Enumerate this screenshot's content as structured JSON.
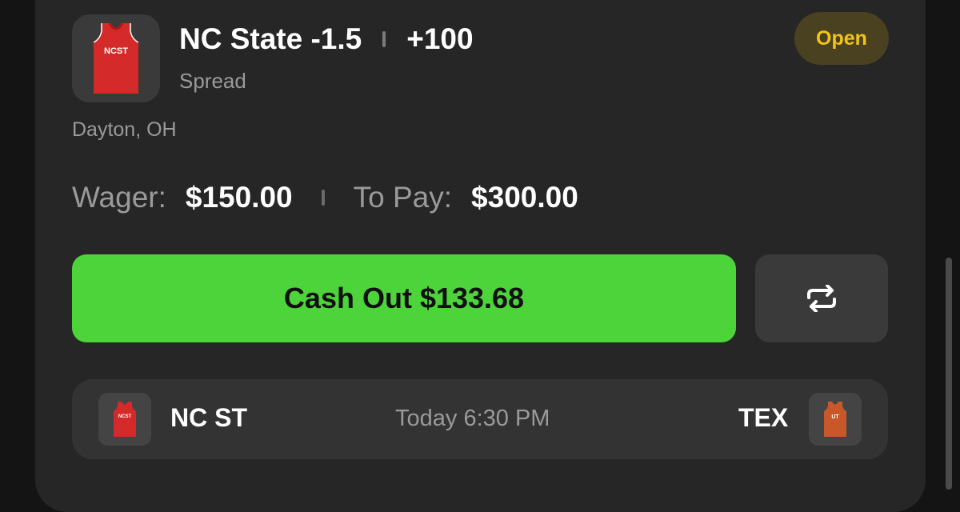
{
  "bet": {
    "selection": "NC State -1.5",
    "odds": "+100",
    "type": "Spread",
    "status": "Open",
    "location": "Dayton, OH"
  },
  "amounts": {
    "wager_label": "Wager:",
    "wager_value": "$150.00",
    "topay_label": "To Pay:",
    "topay_value": "$300.00"
  },
  "actions": {
    "cashout_label": "Cash Out $133.68",
    "repeat_icon": "repeat-icon"
  },
  "matchup": {
    "home_team": "NC ST",
    "home_jersey_text": "NCST",
    "away_team": "TEX",
    "away_jersey_text": "UT",
    "time": "Today 6:30 PM"
  },
  "colors": {
    "cashout_green": "#4ed43b",
    "status_yellow": "#f2c418",
    "ncst_red": "#d42a2a",
    "texas_orange": "#c8582a"
  }
}
